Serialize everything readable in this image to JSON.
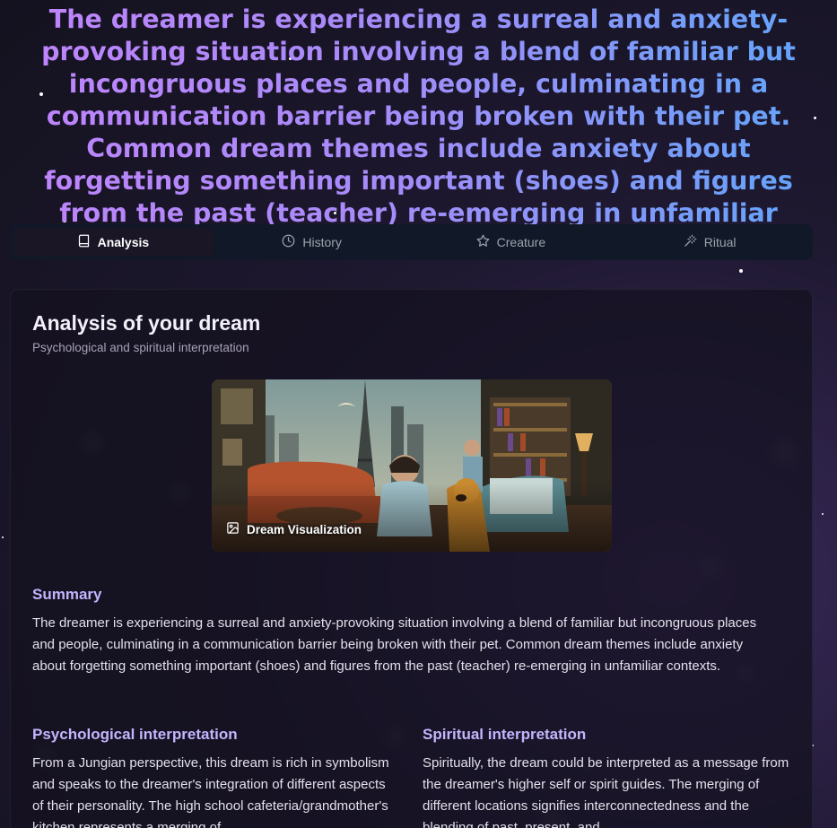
{
  "headline": "The dreamer is experiencing a surreal and anxiety-provoking situation involving a blend of familiar but incongruous places and people, culminating in a communication barrier being broken with their pet. Common dream themes include anxiety about forgetting something important (shoes) and figures from the past (teacher) re-emerging in unfamiliar contexts.",
  "tabs": [
    {
      "label": "Analysis",
      "icon": "book-icon",
      "active": true
    },
    {
      "label": "History",
      "icon": "clock-icon",
      "active": false
    },
    {
      "label": "Creature",
      "icon": "star-icon",
      "active": false
    },
    {
      "label": "Ritual",
      "icon": "magic-wand-icon",
      "active": false
    }
  ],
  "card": {
    "title": "Analysis of your dream",
    "subtitle": "Psychological and spiritual interpretation"
  },
  "visualization": {
    "label": "Dream Visualization",
    "icon": "image-icon"
  },
  "summary": {
    "title": "Summary",
    "text": "The dreamer is experiencing a surreal and anxiety-provoking situation involving a blend of familiar but incongruous places and people, culminating in a communication barrier being broken with their pet. Common dream themes include anxiety about forgetting something important (shoes) and figures from the past (teacher) re-emerging in unfamiliar contexts."
  },
  "psychological": {
    "title": "Psychological interpretation",
    "text": "From a Jungian perspective, this dream is rich in symbolism and speaks to the dreamer's integration of different aspects of their personality. The high school cafeteria/grandmother's kitchen represents a merging of"
  },
  "spiritual": {
    "title": "Spiritual interpretation",
    "text": "Spiritually, the dream could be interpreted as a message from the dreamer's higher self or spirit guides. The merging of different locations signifies interconnectedness and the blending of past, present, and"
  },
  "colors": {
    "accent": "#c4b5fd",
    "headline_start": "#c084fc",
    "headline_end": "#60a5fa",
    "background": "#1e1830"
  }
}
